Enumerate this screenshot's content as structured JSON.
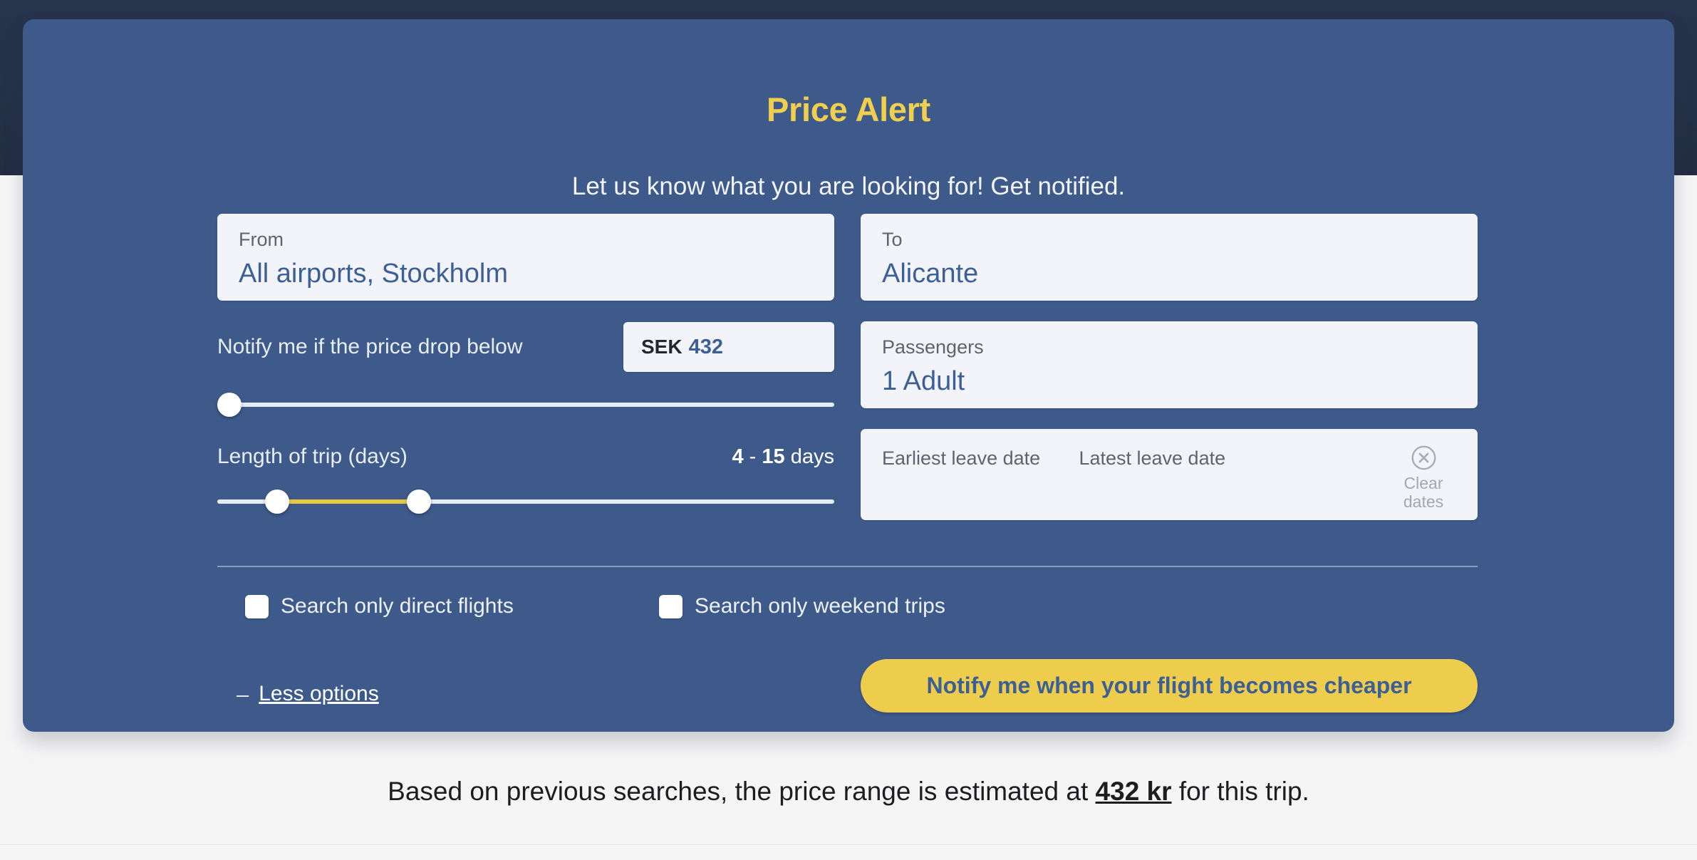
{
  "background": {
    "header_band_color": "#26324a",
    "page_color": "#f5f5f6"
  },
  "card": {
    "bg_color": "#3d5a8a",
    "title": "Price Alert",
    "title_color": "#f0cf4f",
    "subtitle": "Let us know what you are looking for! Get notified."
  },
  "fields": {
    "from": {
      "label": "From",
      "value": "All airports, Stockholm"
    },
    "to": {
      "label": "To",
      "value": "Alicante"
    },
    "passengers": {
      "label": "Passengers",
      "value": "1 Adult"
    },
    "dates": {
      "earliest_placeholder": "Earliest leave date",
      "latest_placeholder": "Latest leave date",
      "clear_line1": "Clear",
      "clear_line2": "dates",
      "clear_icon": "circle-x-icon"
    }
  },
  "price": {
    "label": "Notify me if the price drop below",
    "currency": "SEK",
    "amount": "432",
    "slider": {
      "handle_percent": 0
    }
  },
  "trip_length": {
    "label": "Length of trip (days)",
    "min": "4",
    "separator": " - ",
    "max": "15",
    "unit": " days",
    "slider": {
      "start_percent": 8,
      "end_percent": 32,
      "fill_color": "#e8c740"
    }
  },
  "checkboxes": [
    {
      "label": "Search only direct flights",
      "checked": false
    },
    {
      "label": "Search only weekend trips",
      "checked": false
    }
  ],
  "bottom": {
    "less_options_sign": "–",
    "less_options_label": "Less options",
    "cta_label": "Notify me when your flight becomes cheaper",
    "cta_color": "#efcd4c"
  },
  "footer": {
    "prefix": "Based on previous searches, the price range is estimated at ",
    "highlight": "432 kr",
    "suffix": " for this trip."
  }
}
